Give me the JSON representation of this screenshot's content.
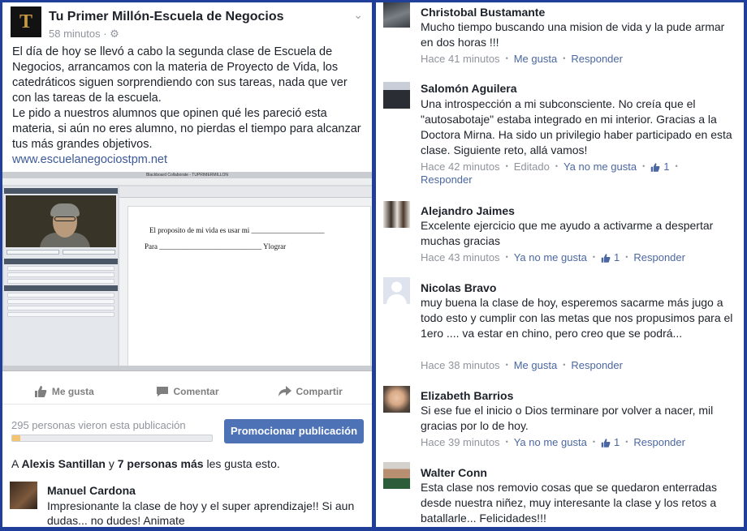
{
  "post": {
    "page_name": "Tu Primer Millón-Escuela de Negocios",
    "time": "58 minutos",
    "avatar_letter": "T",
    "paragraph1": "El día de hoy se llevó a cabo la segunda clase de Escuela de Negocios, arrancamos con la materia de Proyecto de Vida, los catedráticos siguen sorprendiendo con sus tareas, nada que ver con las tareas de la escuela.",
    "paragraph2": "Le pido a nuestros alumnos que opinen qué les pareció esta materia, si aún no eres alumno, no pierdas el tiempo para alcanzar tus más grandes objetivos.",
    "link": "www.escuelanegociostpm.net",
    "screenshot": {
      "window_title": "Blackboard Collaborate - TUPRIMERMILLON",
      "canvas_line1": "El proposito de mi vida es usar mi",
      "canvas_line2_prefix": "Para",
      "canvas_line2_suffix": "Ylograr"
    }
  },
  "actions": {
    "like": "Me gusta",
    "comment": "Comentar",
    "share": "Compartir"
  },
  "promo": {
    "views_text": "295 personas vieron esta publicación",
    "progress_fraction": 0.04,
    "button_label": "Promocionar publicación"
  },
  "likes": {
    "prefix": "A ",
    "name": "Alexis Santillan",
    "mid": " y ",
    "others": "7 personas más",
    "suffix": " les gusta esto."
  },
  "left_comment": {
    "name": "Manuel Cardona",
    "text": "Impresionante la clase de hoy y el super aprendizaje!! Si aun dudas... no dudes! Animate"
  },
  "comments": [
    {
      "name": "Christobal Bustamante",
      "text": "Mucho tiempo buscando una mision de vida y la pude armar en dos horas !!!",
      "time": "Hace 41 minutos",
      "like": "Me gusta",
      "reply": "Responder"
    },
    {
      "name": "Salomón Aguilera",
      "text": "Una introspección a mi subconsciente. No creía que el \"autosabotaje\" estaba integrado en mi interior. Gracias a la Doctora Mirna. Ha sido un privilegio haber participado en esta clase. Siguiente reto, allá vamos!",
      "time": "Hace 42 minutos",
      "edited": "Editado",
      "unlike": "Ya no me gusta",
      "count": "1",
      "reply": "Responder"
    },
    {
      "name": "Alejandro Jaimes",
      "text": "Excelente ejercicio que me ayudo a activarme  a despertar muchas gracias",
      "time": "Hace 43 minutos",
      "unlike": "Ya no me gusta",
      "count": "1",
      "reply": "Responder"
    },
    {
      "name": "Nicolas Bravo",
      "text": "muy buena la clase de hoy, esperemos sacarme más jugo a todo esto y cumplir con las metas que nos propusimos para el 1ero .... va estar en chino, pero creo que se podrá...",
      "time": "Hace 38 minutos",
      "like": "Me gusta",
      "reply": "Responder"
    },
    {
      "name": "Elizabeth Barrios",
      "text": "Si ese fue el inicio o Dios terminare por volver a nacer, mil gracias por lo de hoy.",
      "time": "Hace 39 minutos",
      "unlike": "Ya no me gusta",
      "count": "1",
      "reply": "Responder"
    },
    {
      "name": "Walter Conn",
      "text": "Esta clase nos removio cosas que se quedaron enterradas desde nuestra niñez, muy interesante la clase y los retos a batallarle... Felicidades!!!"
    }
  ],
  "colors": {
    "frame": "#1f3f9a",
    "link": "#4b67a1",
    "promote_button": "#4d72b6",
    "meta_gray": "#90949c"
  }
}
